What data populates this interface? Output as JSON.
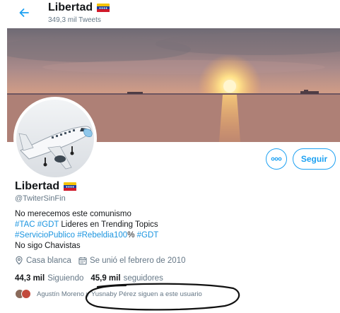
{
  "header": {
    "title": "Libertad",
    "tweet_count": "349,3 mil Tweets",
    "back_icon": "arrow-left-icon"
  },
  "profile": {
    "name": "Libertad",
    "handle": "@TwiterSinFin",
    "flag": "venezuela-flag",
    "bio": {
      "line1": "No merecemos este comunismo",
      "line2_tag1": "#TAC",
      "line2_tag2": "#GDT",
      "line2_text": " Lideres en Trending Topics",
      "line3_tag1": "#ServicioPublico",
      "line3_tag2": "#Rebeldia100",
      "line3_pct": "%",
      "line3_tag3": "#GDT",
      "line4": "No sigo Chavistas"
    },
    "location": "Casa blanca",
    "joined": "Se unió el febrero de 2010"
  },
  "actions": {
    "follow_label": "Seguir",
    "more_icon": "more-options-icon"
  },
  "stats": {
    "following_count": "44,3 mil",
    "following_label": "Siguiendo",
    "followers_count": "45,9 mil",
    "followers_label": "seguidores"
  },
  "known_followers": {
    "text": "Agustín Moreno y Yusnaby Pérez siguen a este usuario"
  },
  "colors": {
    "accent": "#1da1f2",
    "muted": "#657786",
    "text": "#14171a"
  }
}
